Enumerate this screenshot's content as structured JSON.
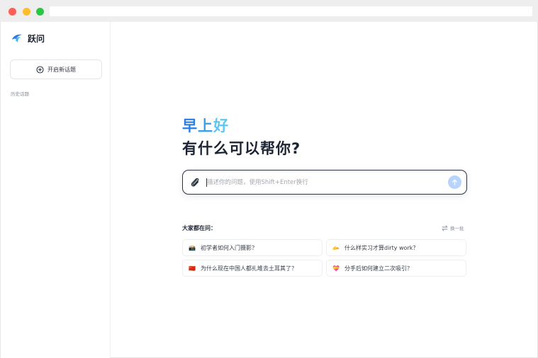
{
  "app": {
    "name": "跃问"
  },
  "sidebar": {
    "new_topic_label": "开启新话题",
    "history_label": "历史话题"
  },
  "main": {
    "greeting": {
      "part1": "早",
      "part2": "上",
      "part3": "好"
    },
    "question": "有什么可以帮你?",
    "input": {
      "placeholder": "描述你的问题，使用Shift+Enter换行",
      "value": ""
    },
    "suggestions": {
      "title": "大家都在问：",
      "refresh_label": "换一批",
      "items": [
        {
          "icon": "📸",
          "icon_name": "camera-icon",
          "text": "初学者如何入门摄影？"
        },
        {
          "icon": "🫴",
          "icon_name": "hand-icon",
          "text": "什么样实习才算dirty work？"
        },
        {
          "icon": "🇨🇳",
          "icon_name": "china-flag-icon",
          "text": "为什么现在中国人都扎堆去土耳其了？"
        },
        {
          "icon": "💝",
          "icon_name": "heart-gift-icon",
          "text": "分手后如何建立二次吸引？"
        }
      ]
    }
  },
  "colors": {
    "brand_blue": "#2a7de1",
    "send_button": "#b9d4fb",
    "border_dark": "#2b3140"
  }
}
